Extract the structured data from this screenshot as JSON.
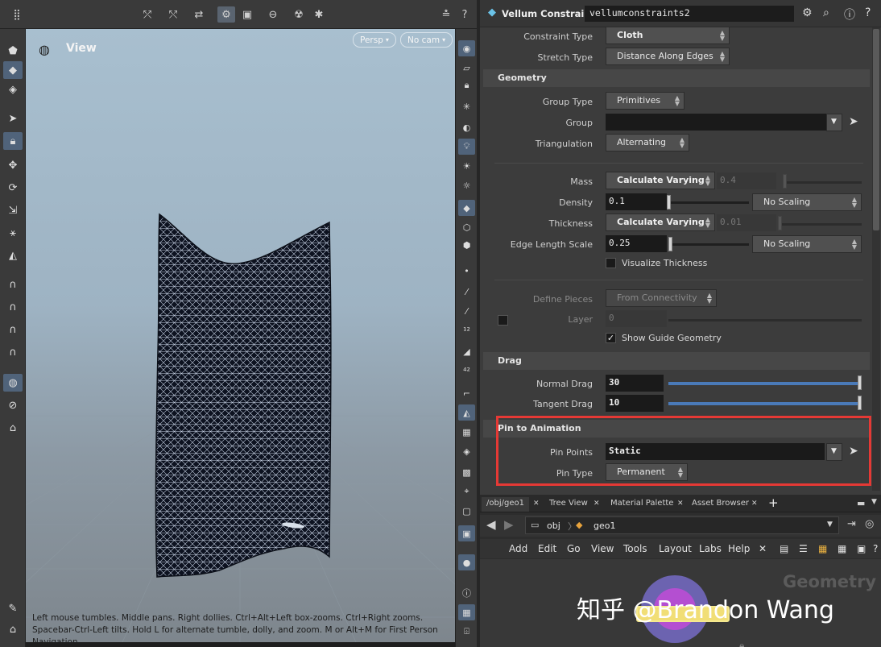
{
  "viewport": {
    "title": "View",
    "persp_label": "Persp",
    "cam_label": "No cam",
    "hint": "Left mouse tumbles. Middle pans. Right dollies. Ctrl+Alt+Left box-zooms. Ctrl+Right zooms. Spacebar-Ctrl-Left tilts. Hold L for alternate tumble, dolly, and zoom. M or Alt+M for First Person Navigation."
  },
  "params": {
    "node_type": "Vellum Constraints",
    "node_name": "vellumconstraints2",
    "constraint_type": {
      "label": "Constraint Type",
      "value": "Cloth"
    },
    "stretch_type": {
      "label": "Stretch Type",
      "value": "Distance Along Edges"
    },
    "geometry_section": "Geometry",
    "group_type": {
      "label": "Group Type",
      "value": "Primitives"
    },
    "group": {
      "label": "Group",
      "value": ""
    },
    "triangulation": {
      "label": "Triangulation",
      "value": "Alternating"
    },
    "mass": {
      "label": "Mass",
      "mode": "Calculate Varying",
      "value": "0.4"
    },
    "density": {
      "label": "Density",
      "value": "0.1",
      "scaling": "No Scaling"
    },
    "thickness": {
      "label": "Thickness",
      "mode": "Calculate Varying",
      "value": "0.01"
    },
    "edge_length_scale": {
      "label": "Edge Length Scale",
      "value": "0.25",
      "scaling": "No Scaling"
    },
    "visualize_thickness": "Visualize Thickness",
    "define_pieces": {
      "label": "Define Pieces",
      "value": "From Connectivity"
    },
    "layer": {
      "label": "Layer",
      "value": "0"
    },
    "show_guide": "Show Guide Geometry",
    "drag_section": "Drag",
    "normal_drag": {
      "label": "Normal Drag",
      "value": "30"
    },
    "tangent_drag": {
      "label": "Tangent Drag",
      "value": "10"
    },
    "pin_section": "Pin to Animation",
    "pin_points": {
      "label": "Pin Points",
      "value": "Static"
    },
    "pin_type": {
      "label": "Pin Type",
      "value": "Permanent"
    }
  },
  "network": {
    "tabs": [
      "/obj/geo1",
      "Tree View",
      "Material Palette",
      "Asset Browser"
    ],
    "path": [
      "obj",
      "geo1"
    ],
    "menu": [
      "Add",
      "Edit",
      "Go",
      "View",
      "Tools",
      "Layout",
      "Labs",
      "Help"
    ],
    "context_label": "Geometry",
    "watermark": "知乎 @Brandon Wang"
  },
  "colors": {
    "highlight": "#e53935",
    "accent_blue": "#4a7ab8"
  }
}
